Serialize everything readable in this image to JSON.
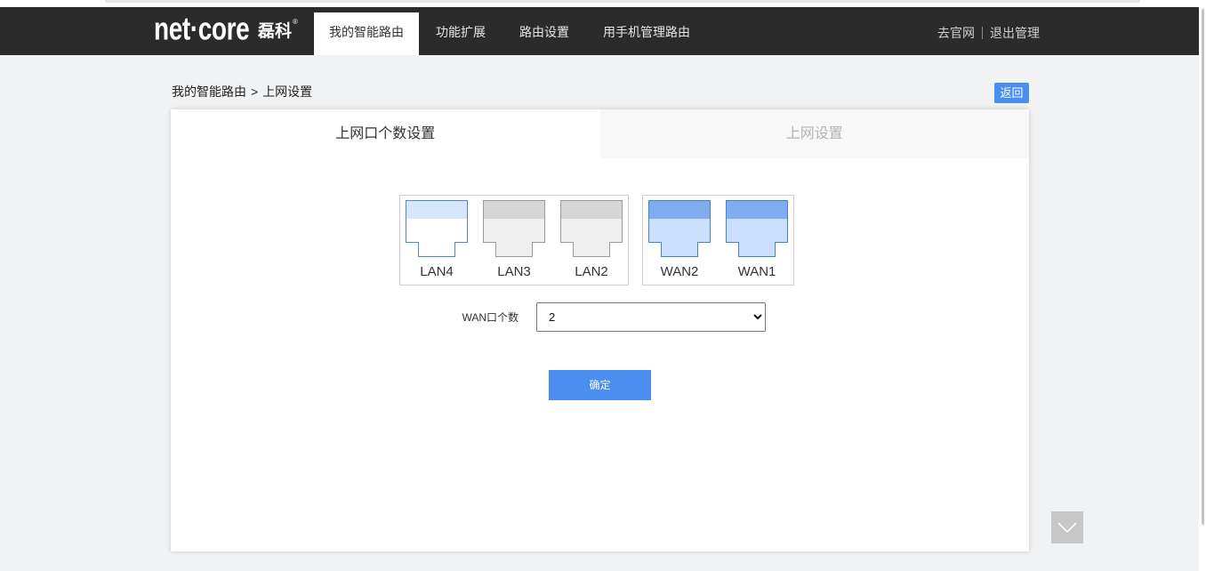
{
  "colors": {
    "header_bg": "#2b2b2b",
    "page_bg": "#f1f2f4",
    "accent": "#4a8ff0",
    "scroll_button_bg": "#c7c7c7"
  },
  "header": {
    "logo": {
      "text": "net·core",
      "cn": "磊科",
      "mark": "®"
    },
    "tabs": [
      {
        "label": "我的智能路由",
        "active": true
      },
      {
        "label": "功能扩展",
        "active": false
      },
      {
        "label": "路由设置",
        "active": false
      },
      {
        "label": "用手机管理路由",
        "active": false
      }
    ],
    "links": {
      "official_site": "去官网",
      "logout": "退出管理"
    }
  },
  "breadcrumb": {
    "home": "我的智能路由",
    "separator": ">",
    "current": "上网设置"
  },
  "back_button": {
    "label": "返回"
  },
  "panel": {
    "tabs": [
      {
        "label": "上网口个数设置",
        "active": true
      },
      {
        "label": "上网设置",
        "active": false
      }
    ]
  },
  "ports": {
    "lan": [
      {
        "label": "LAN4",
        "highlighted": true
      },
      {
        "label": "LAN3",
        "highlighted": false
      },
      {
        "label": "LAN2",
        "highlighted": false
      }
    ],
    "wan": [
      {
        "label": "WAN2"
      },
      {
        "label": "WAN1"
      }
    ]
  },
  "port_colors": {
    "lan_highlighted": {
      "band": "#d5e5fb",
      "body": "#ffffff",
      "stroke": "#4f86cf"
    },
    "lan_idle": {
      "band": "#d6d6d6",
      "body": "#efefef",
      "stroke": "#9a9a9a"
    },
    "wan": {
      "band": "#7eaef0",
      "body": "#c9dffb",
      "stroke": "#4a80c8"
    }
  },
  "wan_count": {
    "label": "WAN口个数",
    "value": "2"
  },
  "confirm_button": {
    "label": "确定"
  },
  "icons": {
    "scroll_down": "chevron-down-icon",
    "port": "ethernet-port-icon"
  }
}
